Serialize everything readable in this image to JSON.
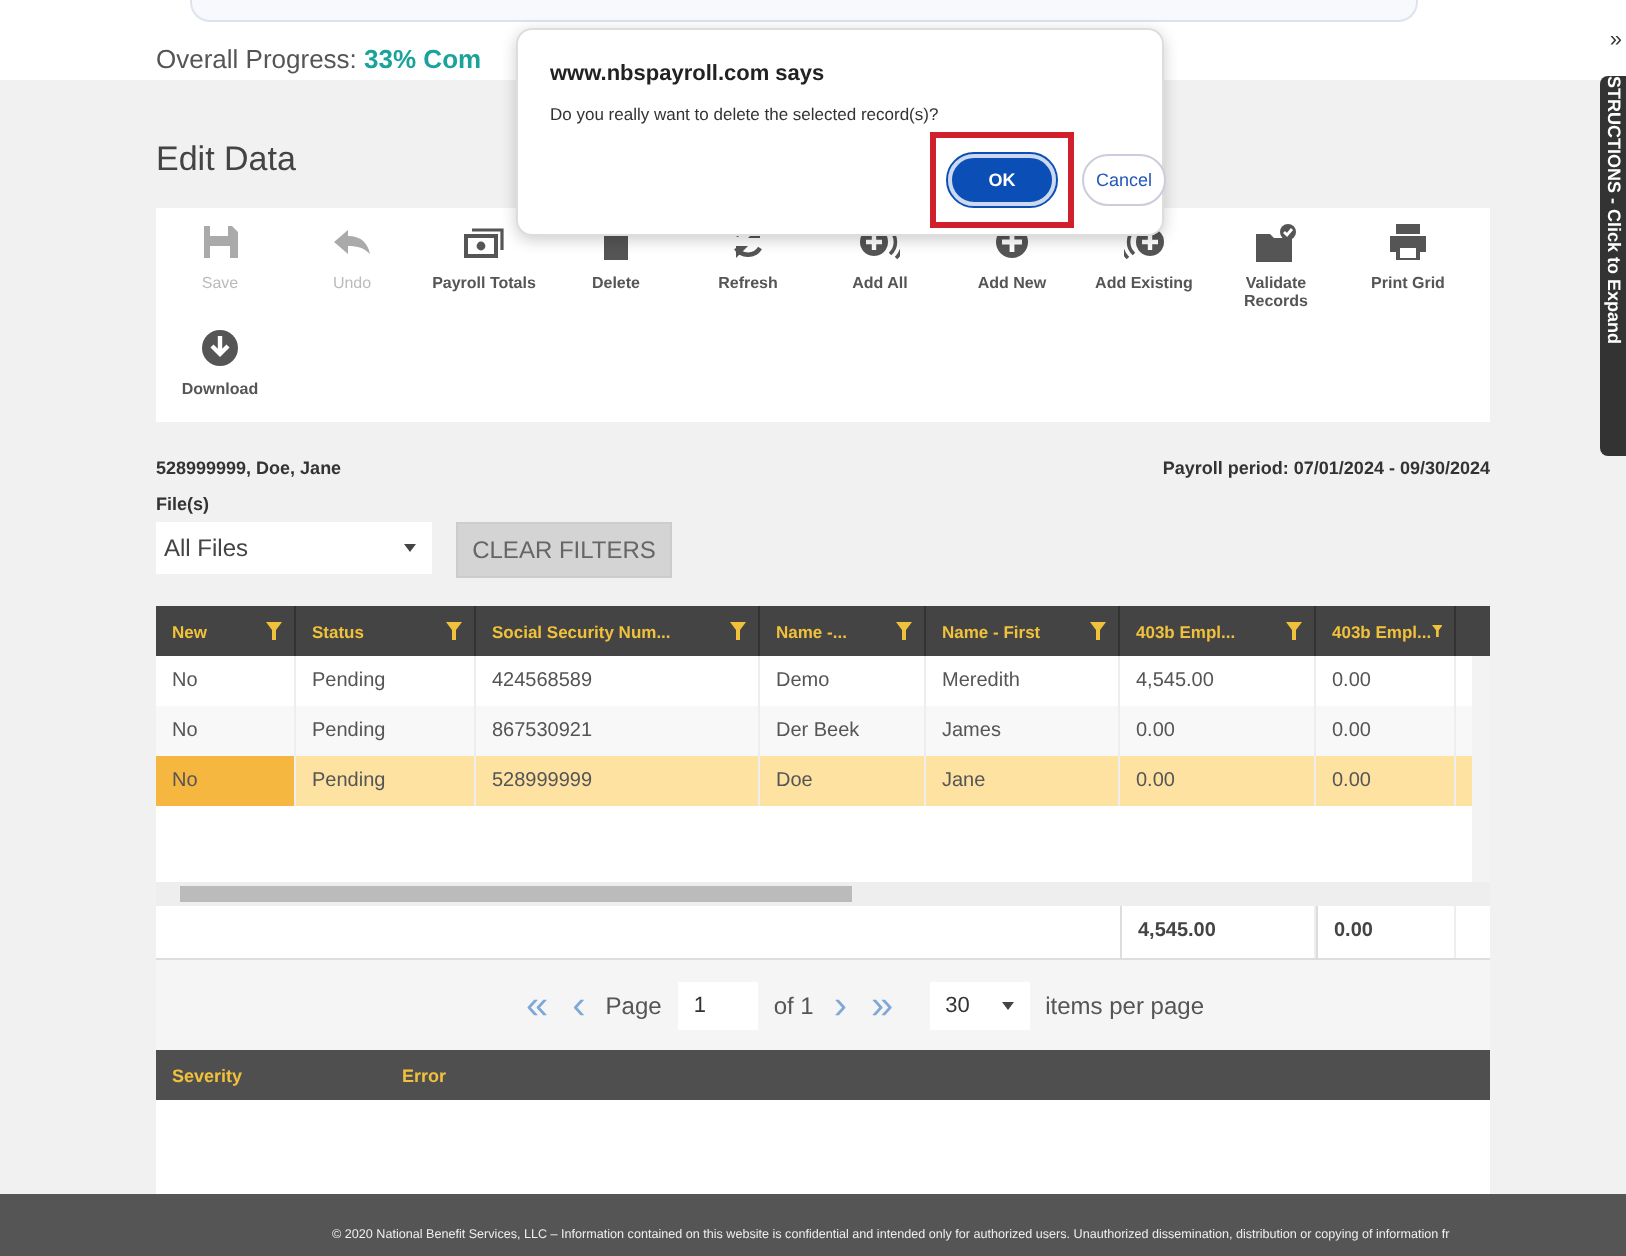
{
  "progress": {
    "label": "Overall Progress:",
    "value": "33% Com"
  },
  "page_title": "Edit Data",
  "toolbar": [
    {
      "label": "Save",
      "disabled": true
    },
    {
      "label": "Undo",
      "disabled": true
    },
    {
      "label": "Payroll Totals",
      "disabled": false
    },
    {
      "label": "Delete",
      "disabled": false
    },
    {
      "label": "Refresh",
      "disabled": false
    },
    {
      "label": "Add All",
      "disabled": false
    },
    {
      "label": "Add New",
      "disabled": false
    },
    {
      "label": "Add Existing",
      "disabled": false
    },
    {
      "label": "Validate Records",
      "disabled": false
    },
    {
      "label": "Print Grid",
      "disabled": false
    },
    {
      "label": "Download",
      "disabled": false
    }
  ],
  "employee": "528999999, Doe, Jane",
  "payroll_period": "Payroll period: 07/01/2024 - 09/30/2024",
  "files": {
    "label": "File(s)",
    "value": "All Files"
  },
  "clear_filters": "CLEAR FILTERS",
  "table": {
    "columns": [
      "New",
      "Status",
      "Social Security Num...",
      "Name -...",
      "Name - First",
      "403b Empl...",
      "403b Empl..."
    ],
    "rows": [
      {
        "cells": [
          "No",
          "Pending",
          "424568589",
          "Demo",
          "Meredith",
          "4,545.00",
          "0.00"
        ],
        "selected": false
      },
      {
        "cells": [
          "No",
          "Pending",
          "867530921",
          "Der Beek",
          "James",
          "0.00",
          "0.00"
        ],
        "selected": false
      },
      {
        "cells": [
          "No",
          "Pending",
          "528999999",
          "Doe",
          "Jane",
          "0.00",
          "0.00"
        ],
        "selected": true
      }
    ],
    "totals": [
      "4,545.00",
      "0.00"
    ]
  },
  "pager": {
    "first": "«",
    "prev": "‹",
    "page_label": "Page",
    "page": "1",
    "of": "of 1",
    "next": "›",
    "last": "»",
    "per_page": "30",
    "per_page_label": "items per page"
  },
  "errors": {
    "columns": [
      "Severity",
      "Error"
    ]
  },
  "footer": "© 2020 National Benefit Services, LLC – Information contained on this website is confidential and intended only for authorized users. Unauthorized dissemination, distribution or copying of information fr",
  "side_tab": {
    "label": "STRUCTIONS - Click to Expand",
    "collapse": "»"
  },
  "dialog": {
    "title": "www.nbspayroll.com says",
    "message": "Do you really want to delete the selected record(s)?",
    "ok": "OK",
    "cancel": "Cancel"
  }
}
